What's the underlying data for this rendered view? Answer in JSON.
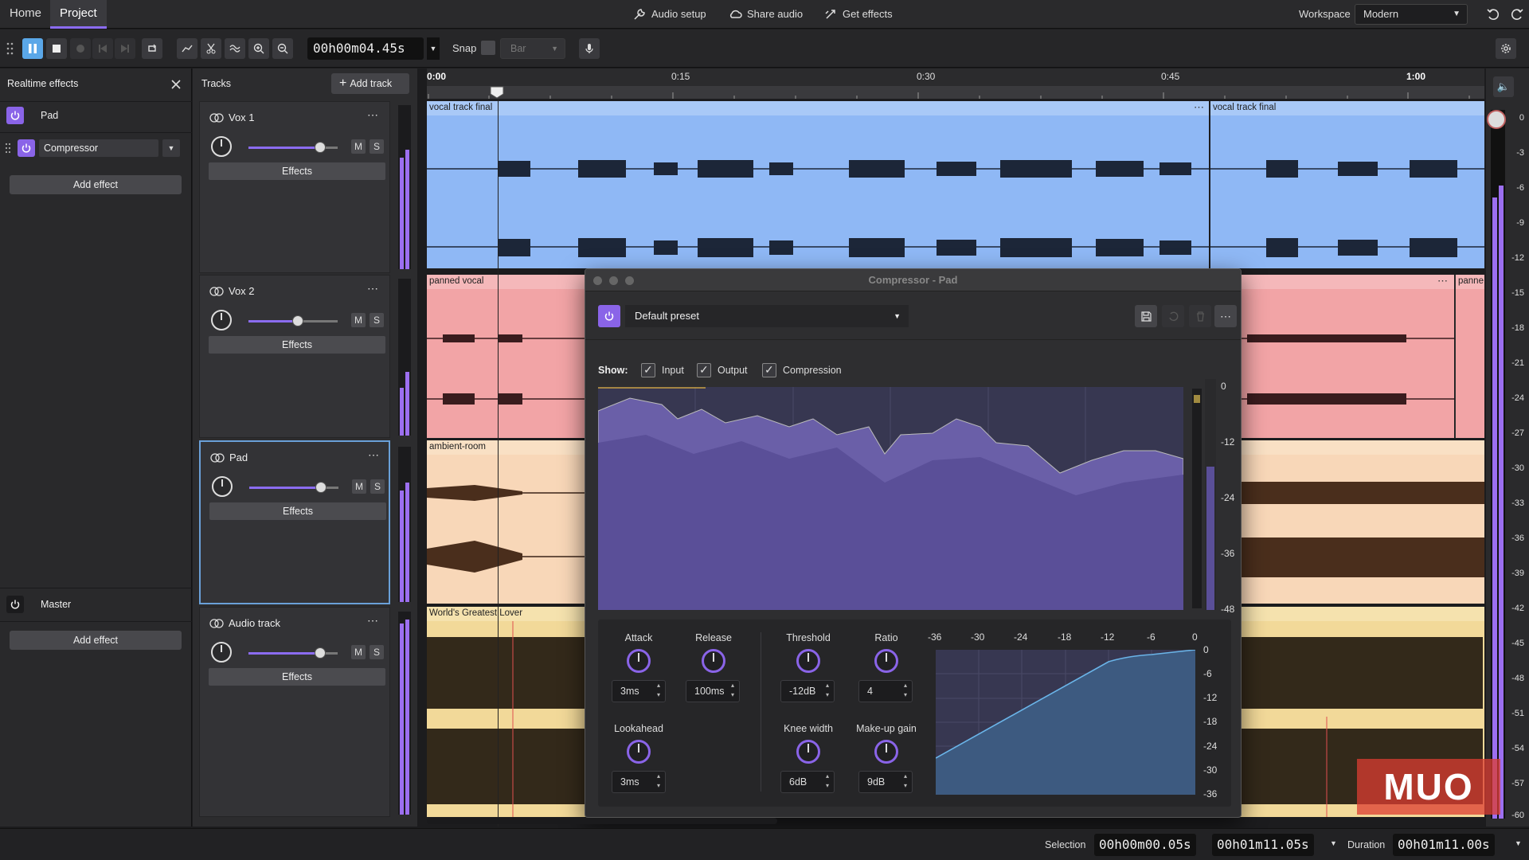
{
  "menubar": {
    "tabs": [
      {
        "label": "Home"
      },
      {
        "label": "Project"
      }
    ],
    "audio_setup": "Audio setup",
    "share_audio": "Share audio",
    "get_effects": "Get effects",
    "workspace_label": "Workspace",
    "workspace_value": "Modern"
  },
  "toolbar": {
    "timecode": "00h00m04.45s",
    "snap_label": "Snap",
    "snap_unit": "Bar"
  },
  "effects_panel": {
    "title": "Realtime effects",
    "track_name": "Pad",
    "effect_name": "Compressor",
    "add_effect": "Add effect",
    "master_name": "Master",
    "master_add_effect": "Add effect"
  },
  "tracks_panel": {
    "title": "Tracks",
    "add_track": "Add track",
    "tracks": [
      {
        "name": "Vox 1",
        "effects": "Effects",
        "mute": "M",
        "solo": "S",
        "gain": 0.8
      },
      {
        "name": "Vox 2",
        "effects": "Effects",
        "mute": "M",
        "solo": "S",
        "gain": 0.55
      },
      {
        "name": "Pad",
        "effects": "Effects",
        "mute": "M",
        "solo": "S",
        "gain": 0.8
      },
      {
        "name": "Audio track",
        "effects": "Effects",
        "mute": "M",
        "solo": "S",
        "gain": 0.8
      }
    ]
  },
  "ruler": {
    "ticks": [
      "0:00",
      "0:15",
      "0:30",
      "0:45",
      "1:00"
    ]
  },
  "clips": {
    "vox1_a": "vocal track final",
    "vox1_b": "vocal track final",
    "vox2_a": "panned vocal",
    "vox2_b": "panne",
    "pad": "ambient-room",
    "audio": "World's Greatest Lover"
  },
  "colors": {
    "vox1": "#8fb8f5",
    "vox2": "#f2a4a6",
    "pad": "#f8d7b8",
    "audio": "#f2d999",
    "accent": "#8b6cf0"
  },
  "compressor": {
    "title": "Compressor - Pad",
    "preset": "Default preset",
    "show_label": "Show:",
    "show_input": "Input",
    "show_output": "Output",
    "show_compression": "Compression",
    "graph_db": [
      "0",
      "-12",
      "-24",
      "-36",
      "-48"
    ],
    "attack_label": "Attack",
    "attack_value": "3ms",
    "release_label": "Release",
    "release_value": "100ms",
    "lookahead_label": "Lookahead",
    "lookahead_value": "3ms",
    "threshold_label": "Threshold",
    "threshold_value": "-12dB",
    "ratio_label": "Ratio",
    "ratio_value": "4",
    "knee_label": "Knee width",
    "knee_value": "6dB",
    "makeup_label": "Make-up gain",
    "makeup_value": "9dB",
    "curve_x": [
      "-36",
      "-30",
      "-24",
      "-18",
      "-12",
      "-6",
      "0"
    ],
    "curve_y": [
      "0",
      "-6",
      "-12",
      "-18",
      "-24",
      "-30",
      "-36"
    ]
  },
  "right_meter": {
    "ticks": [
      "0",
      "-3",
      "-6",
      "-9",
      "-12",
      "-15",
      "-18",
      "-21",
      "-24",
      "-27",
      "-30",
      "-33",
      "-36",
      "-39",
      "-42",
      "-45",
      "-48",
      "-51",
      "-54",
      "-57",
      "-60"
    ]
  },
  "status": {
    "selection_label": "Selection",
    "selection_start": "00h00m00.05s",
    "selection_end": "00h01m11.05s",
    "duration_label": "Duration",
    "duration_value": "00h01m11.00s"
  },
  "watermark": "MUO"
}
